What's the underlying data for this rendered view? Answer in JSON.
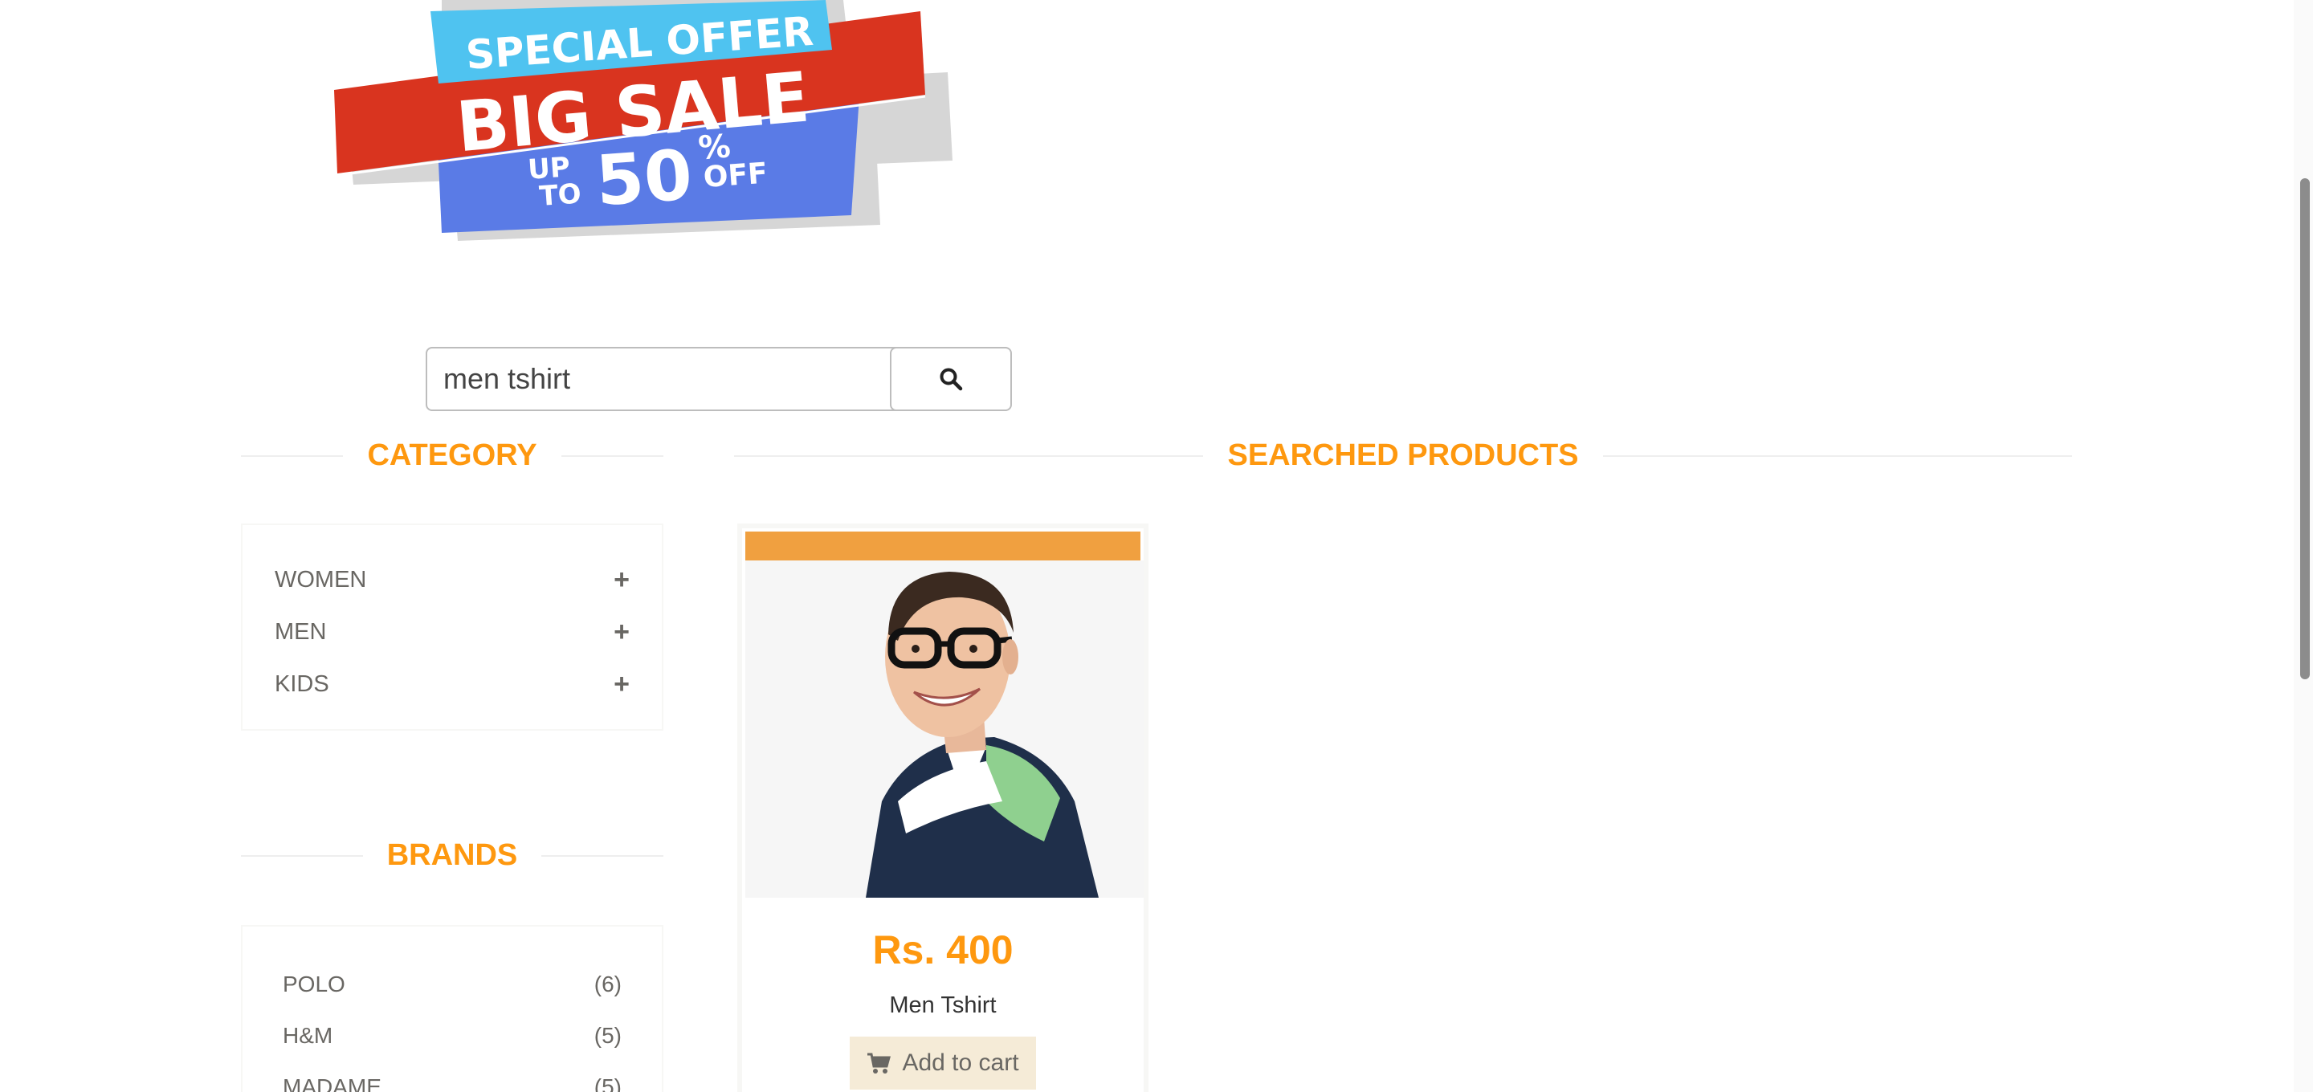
{
  "banner": {
    "line1": "SPECIAL OFFER",
    "line2": "BIG SALE",
    "up": "UP",
    "to": "TO",
    "pct_num": "50",
    "pct_sign": "%",
    "off": "OFF",
    "colors": {
      "top": "#4fc3f0",
      "mid": "#d9341f",
      "bottom": "#5a7be6"
    }
  },
  "search": {
    "value": "men tshirt",
    "button_icon": "search-icon"
  },
  "category": {
    "title": "CATEGORY",
    "items": [
      {
        "label": "WOMEN",
        "icon": "plus-icon"
      },
      {
        "label": "MEN",
        "icon": "plus-icon"
      },
      {
        "label": "KIDS",
        "icon": "plus-icon"
      }
    ]
  },
  "brands": {
    "title": "BRANDS",
    "items": [
      {
        "label": "POLO",
        "count": "(6)"
      },
      {
        "label": "H&M",
        "count": "(5)"
      },
      {
        "label": "MADAME",
        "count": "(5)"
      }
    ]
  },
  "products": {
    "title": "SEARCHED PRODUCTS",
    "items": [
      {
        "price": "Rs. 400",
        "name": "Men Tshirt",
        "cart_label": "Add to cart",
        "cart_icon": "shopping-cart-icon"
      }
    ]
  },
  "theme": {
    "accent": "#fe980f",
    "text": "#696763"
  }
}
